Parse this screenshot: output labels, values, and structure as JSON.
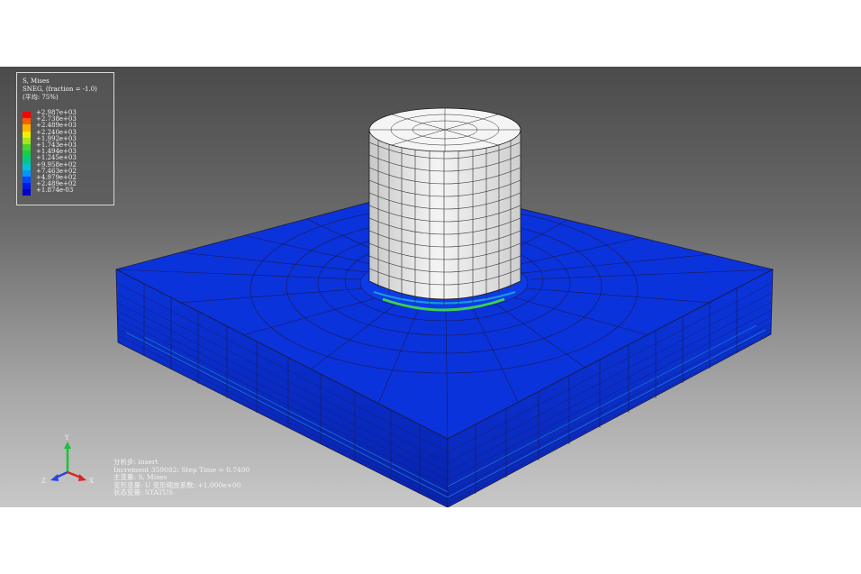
{
  "legend": {
    "title": "S, Mises",
    "subtitle": "SNEG, (fraction = -1.0)",
    "average": "(平均: 75%)",
    "ticks": [
      "+2.987e+03",
      "+2.738e+03",
      "+2.489e+03",
      "+2.240e+03",
      "+1.992e+03",
      "+1.743e+03",
      "+1.494e+03",
      "+1.245e+03",
      "+9.958e+02",
      "+7.463e+02",
      "+4.979e+02",
      "+2.489e+02",
      "+1.874e-03"
    ],
    "colors": [
      "#ff0000",
      "#ff5a00",
      "#ffb400",
      "#f0f000",
      "#a5e61e",
      "#4bd32d",
      "#12d04a",
      "#00c88c",
      "#00c3d2",
      "#0096ff",
      "#0046ff",
      "#0019e6",
      "#0000c8"
    ]
  },
  "info": {
    "step": "分析步: insert",
    "increment": "Increment    359082: Step Time =    0.7400",
    "primary": "主变量: S, Mises",
    "deformed": "变形变量: U   变形缩放系数: +1.000e+00",
    "status": "状态变量: STATUS"
  },
  "triad": {
    "y": "Y",
    "z": "Z",
    "x": "X"
  },
  "colors": {
    "block_top": "#0a2fd6",
    "block_side": "#0a2cc4",
    "cylinder": "#e8e8e8",
    "mesh": "#1a1a40"
  }
}
